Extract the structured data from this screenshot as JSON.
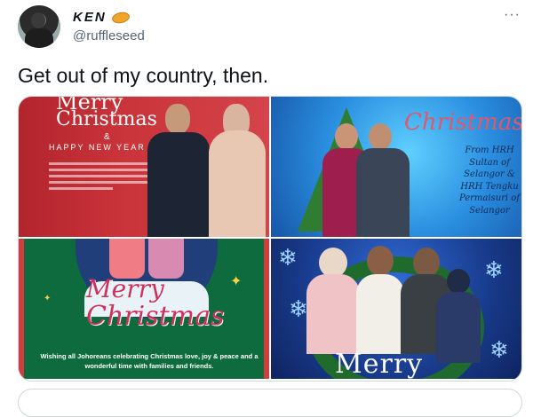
{
  "tweet": {
    "display_name": "KEN",
    "handle": "@ruffleseed",
    "text": "Get out of my country, then.",
    "more_label": "···"
  },
  "images": [
    {
      "merry": "Merry",
      "christmas": "Christmas",
      "amp": "&",
      "subtitle": "HAPPY NEW YEAR"
    },
    {
      "title": "Christmas",
      "caption": "From HRH Sultan of Selangor & HRH Tengku Permaisuri of Selangor"
    },
    {
      "merry": "Merry",
      "christmas": "Christmas",
      "wish": "Wishing all Johoreans celebrating Christmas love, joy & peace and a wonderful time with families and friends."
    },
    {
      "merry": "Merry"
    }
  ],
  "icons": {
    "badge": "orange-badge-icon",
    "more": "more-options-icon"
  },
  "colors": {
    "text_primary": "#0f1419",
    "text_secondary": "#536471",
    "border": "#cfd9de"
  }
}
